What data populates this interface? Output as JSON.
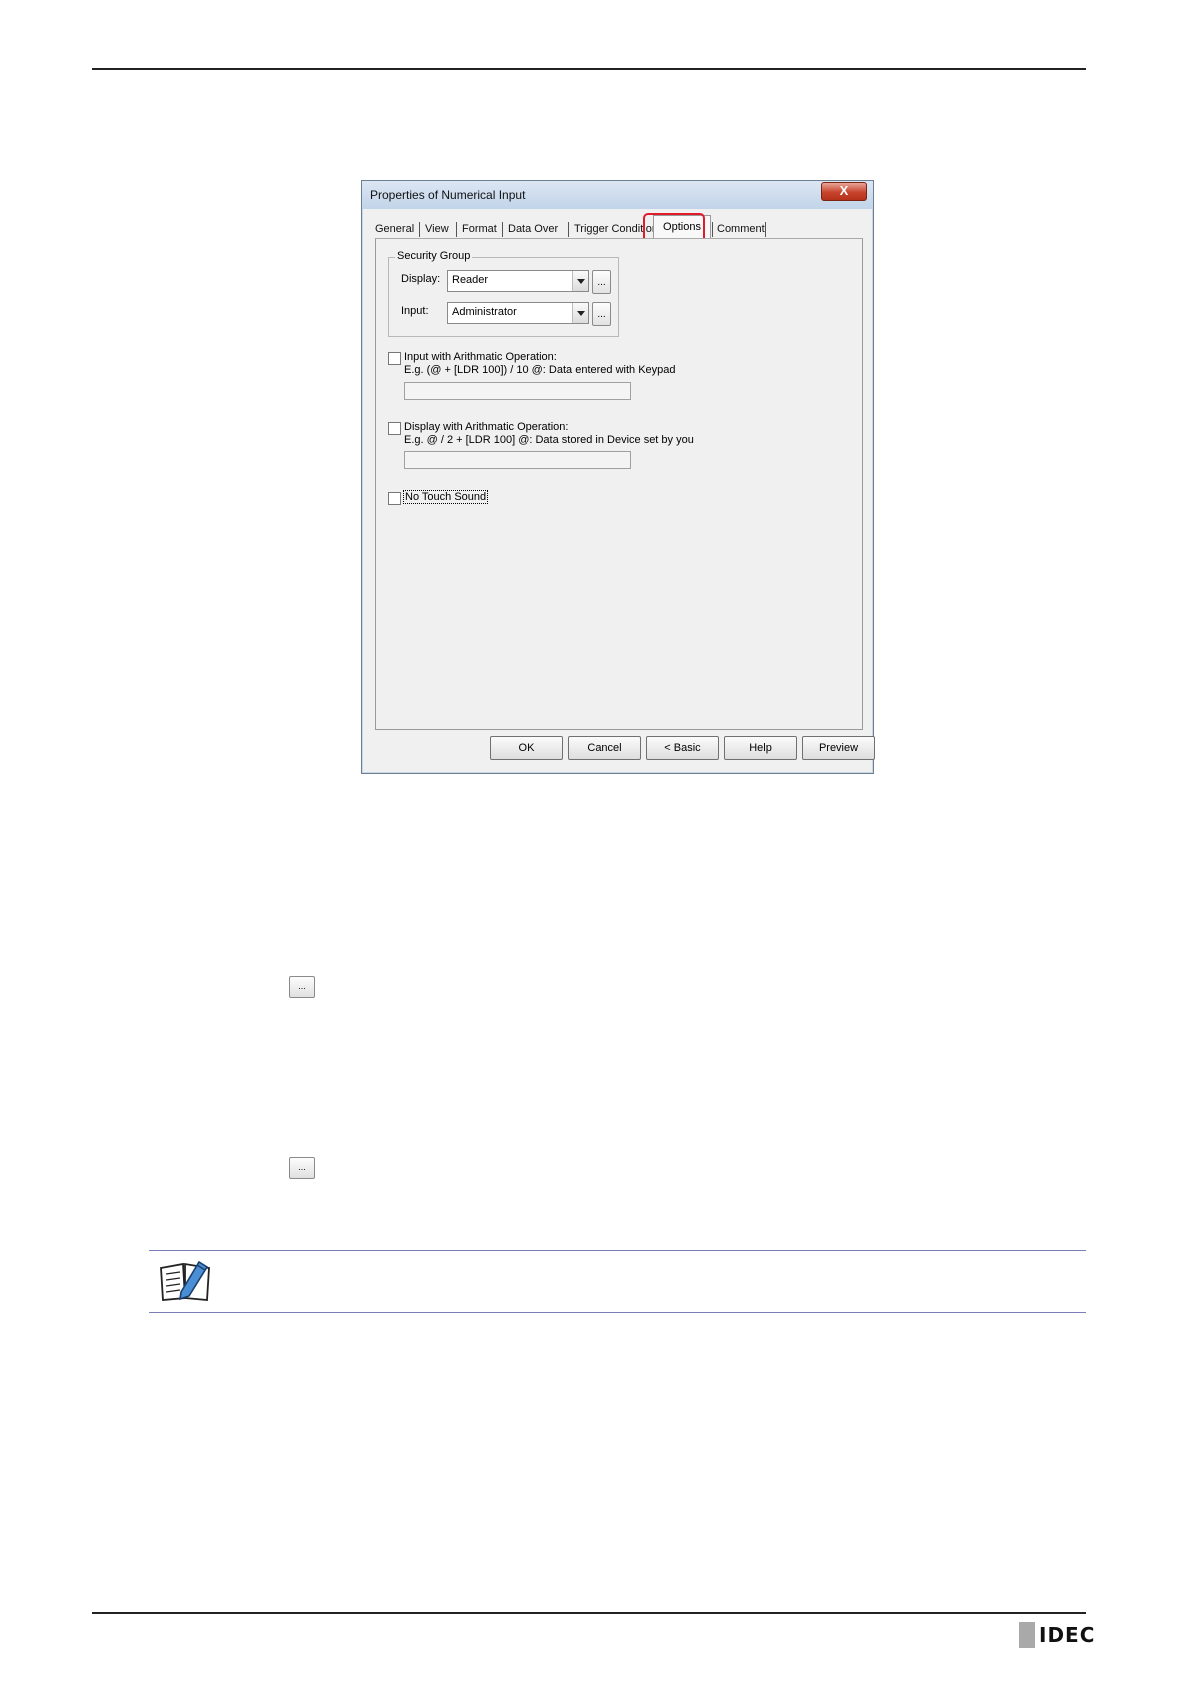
{
  "dialog": {
    "title": "Properties of Numerical Input",
    "close_label": "X",
    "tabs": [
      "General",
      "View",
      "Format",
      "Data Over",
      "Trigger Condition",
      "Options",
      "Comment"
    ],
    "active_tab": "Options",
    "security_group": {
      "label": "Security Group",
      "display_label": "Display:",
      "display_value": "Reader",
      "input_label": "Input:",
      "input_value": "Administrator",
      "browse_label": "..."
    },
    "input_arith": {
      "label": "Input with Arithmatic Operation:",
      "example": "E.g. (@ + [LDR 100]) / 10    @: Data entered with Keypad"
    },
    "display_arith": {
      "label": "Display with Arithmatic Operation:",
      "example": "E.g. @ / 2 + [LDR 100]    @: Data stored in Device set by you"
    },
    "no_touch_sound": "No Touch Sound",
    "buttons": {
      "ok": "OK",
      "cancel": "Cancel",
      "basic": "< Basic",
      "help": "Help",
      "preview": "Preview"
    }
  },
  "page": {
    "browse_button_1": "...",
    "browse_button_2": "...",
    "note_icon": "note-book-pencil-icon",
    "logo": "IDEC"
  }
}
